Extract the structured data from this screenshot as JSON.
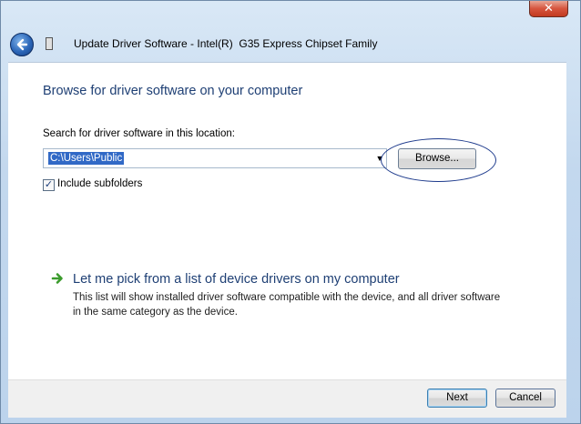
{
  "window": {
    "title": "Update Driver Software - Intel(R)  G35 Express Chipset Family",
    "close_glyph": "✕"
  },
  "main": {
    "heading": "Browse for driver software on your computer",
    "search_label": "Search for driver software in this location:",
    "location_value": "C:\\Users\\Public",
    "browse_label": "Browse...",
    "include_subfolders_label": "Include subfolders",
    "include_subfolders_checked": true,
    "check_glyph": "✓"
  },
  "pick": {
    "title": "Let me pick from a list of device drivers on my computer",
    "description": "This list will show installed driver software compatible with the device, and all driver software in the same category as the device."
  },
  "footer": {
    "next_label": "Next",
    "cancel_label": "Cancel"
  },
  "colors": {
    "heading": "#1e3f74",
    "selection": "#3169c6",
    "arrow_green": "#3a9b2c"
  }
}
